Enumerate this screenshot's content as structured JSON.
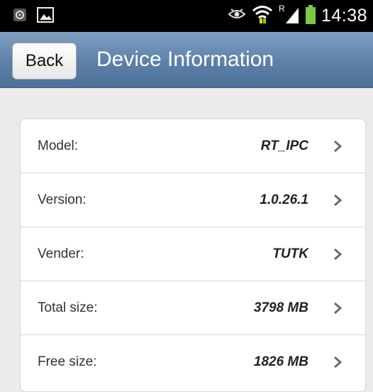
{
  "status_bar": {
    "time": "14:38",
    "icons": [
      "notification-icon",
      "image-icon",
      "eye-icon",
      "wifi-icon",
      "signal-icon",
      "battery-icon"
    ],
    "roaming_indicator": "R"
  },
  "header": {
    "back_label": "Back",
    "title": "Device Information"
  },
  "info_rows": [
    {
      "label": "Model:",
      "value": "RT_IPC"
    },
    {
      "label": "Version:",
      "value": "1.0.26.1"
    },
    {
      "label": "Vender:",
      "value": "TUTK"
    },
    {
      "label": "Total size:",
      "value": "3798 MB"
    },
    {
      "label": "Free size:",
      "value": "1826 MB"
    }
  ],
  "colors": {
    "titlebar": "#5d80a8",
    "background": "#ebebeb",
    "battery": "#7ac943"
  }
}
